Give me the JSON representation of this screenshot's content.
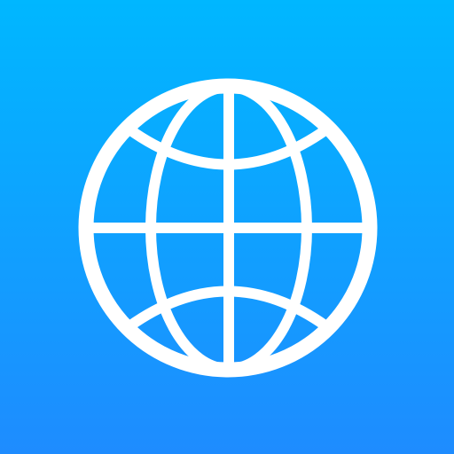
{
  "app_icon": {
    "icon": "globe-icon",
    "colors": {
      "gradient_top": "#00b7ff",
      "gradient_bottom": "#1e8cff",
      "glyph": "#ffffff"
    }
  }
}
